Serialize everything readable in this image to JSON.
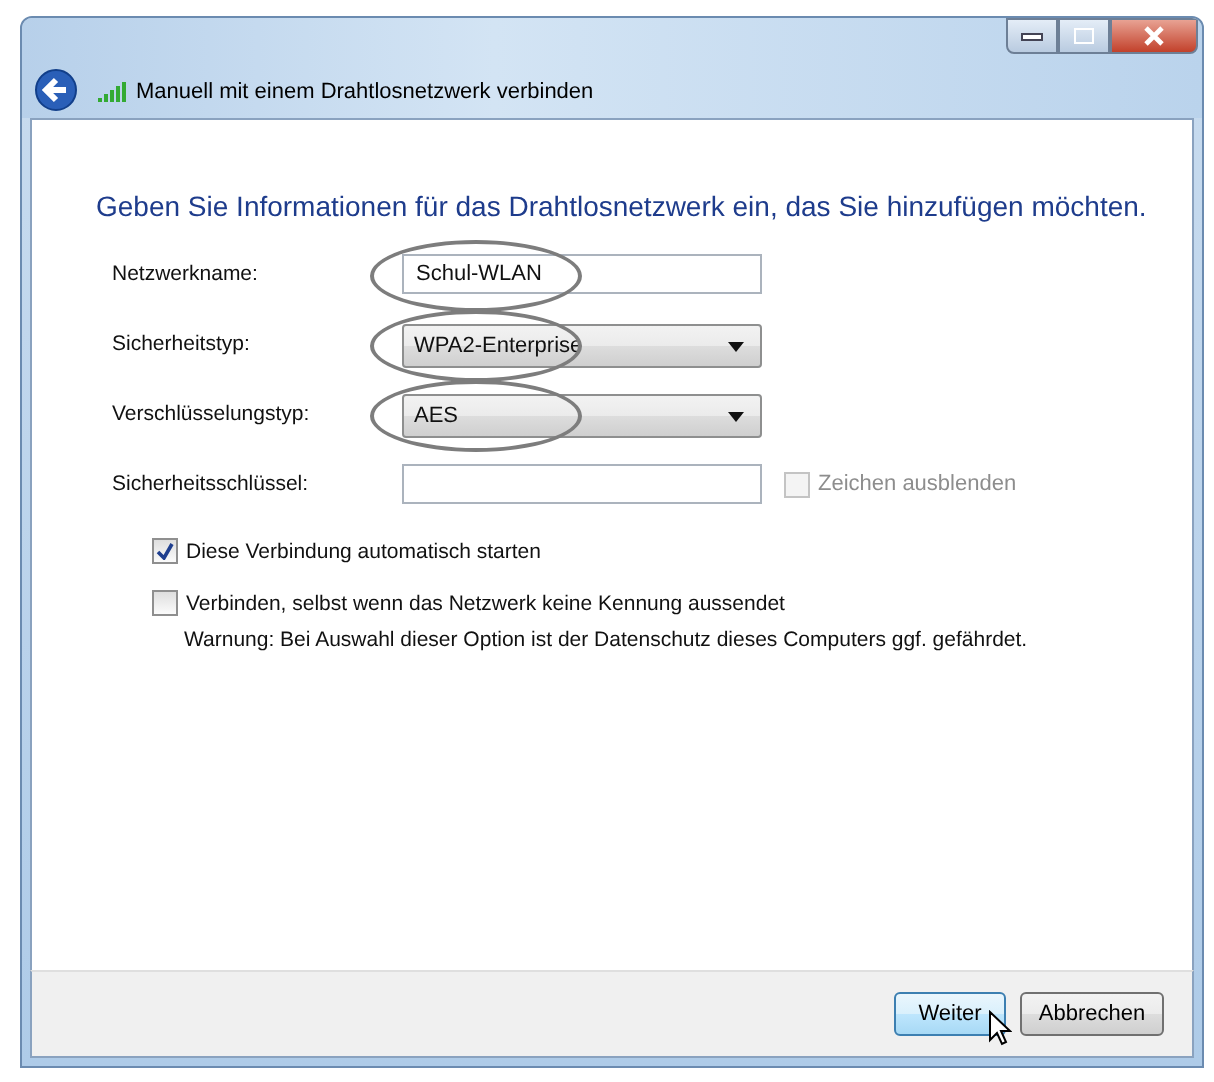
{
  "window": {
    "title": "Manuell mit einem Drahtlosnetzwerk verbinden"
  },
  "heading": "Geben Sie Informationen für das Drahtlosnetzwerk ein, das Sie hinzufügen möchten.",
  "fields": [
    {
      "kind": "text",
      "label": "Netzwerkname:",
      "value": "Schul-WLAN",
      "circled": true
    },
    {
      "kind": "select",
      "label": "Sicherheitstyp:",
      "value": "WPA2-Enterprise",
      "circled": true
    },
    {
      "kind": "select",
      "label": "Verschlüsselungstyp:",
      "value": "AES",
      "circled": true
    },
    {
      "kind": "text",
      "label": "Sicherheitsschlüssel:",
      "side_option": {
        "label": "Zeichen ausblenden",
        "checked": false,
        "disabled": true
      }
    }
  ],
  "options": [
    {
      "label": "Diese Verbindung automatisch starten",
      "checked": true
    },
    {
      "label": "Verbinden, selbst wenn das Netzwerk keine Kennung aussendet",
      "checked": false,
      "note": "Warnung: Bei Auswahl dieser Option ist der Datenschutz dieses Computers ggf. gefährdet."
    }
  ],
  "buttons": [
    {
      "label": "Weiter",
      "default": true,
      "hovered": true
    },
    {
      "label": "Abbrechen",
      "default": false,
      "hovered": false
    }
  ]
}
